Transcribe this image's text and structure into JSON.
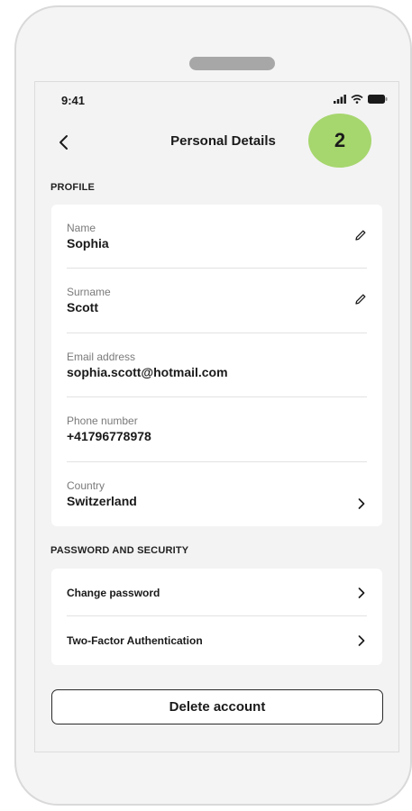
{
  "status_bar": {
    "time": "9:41"
  },
  "header": {
    "title": "Personal Details",
    "step_badge": "2"
  },
  "profile": {
    "section_label": "PROFILE",
    "fields": [
      {
        "label": "Name",
        "value": "Sophia",
        "action": "edit-icon"
      },
      {
        "label": "Surname",
        "value": "Scott",
        "action": "edit-icon"
      },
      {
        "label": "Email address",
        "value": "sophia.scott@hotmail.com"
      },
      {
        "label": "Phone number",
        "value": "+41796778978"
      },
      {
        "label": "Country",
        "value": "Switzerland",
        "action": "chevron-right-icon"
      }
    ]
  },
  "security": {
    "section_label": "PASSWORD AND SECURITY",
    "items": [
      {
        "label": "Change password"
      },
      {
        "label": "Two-Factor Authentication"
      }
    ]
  },
  "actions": {
    "delete_account": "Delete account"
  },
  "colors": {
    "badge": "#a6d66e",
    "card": "#ffffff",
    "screen": "#f3f3f3"
  }
}
